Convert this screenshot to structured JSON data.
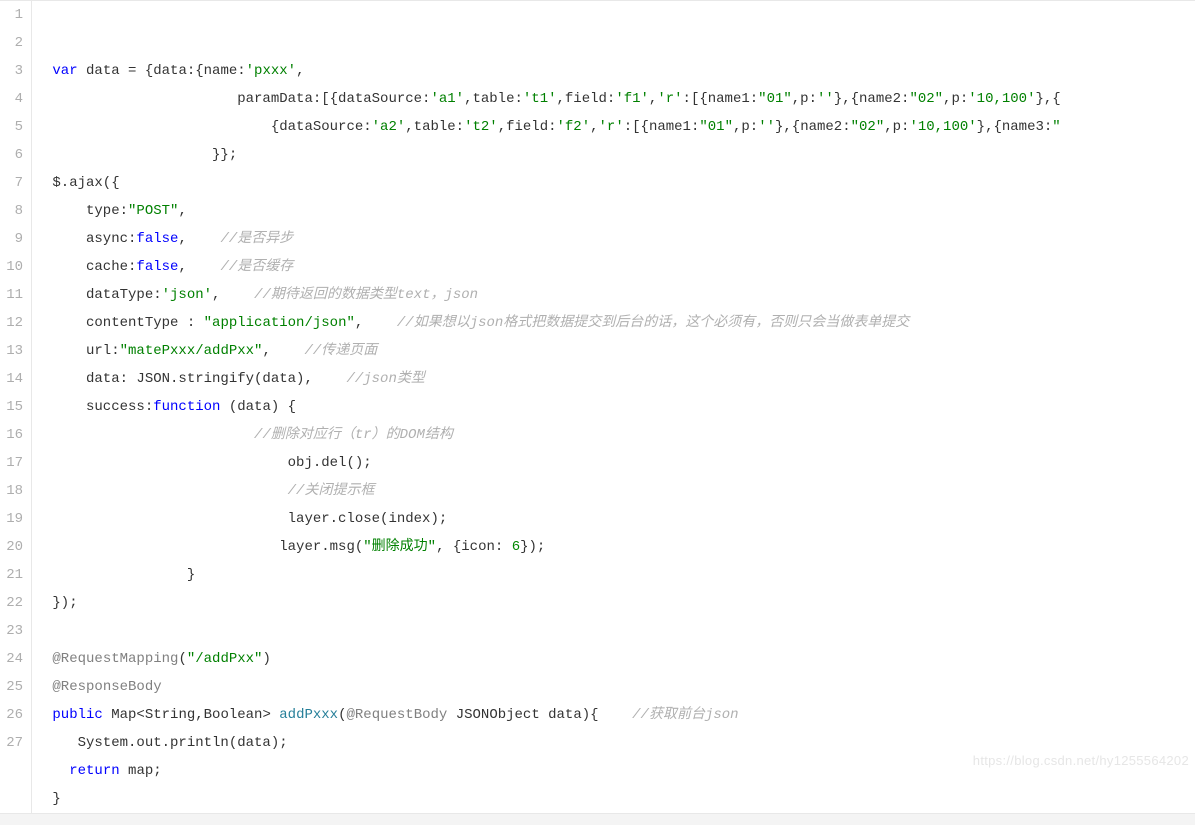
{
  "lines": [
    {
      "n": 1,
      "segs": [
        {
          "t": " ",
          "c": ""
        },
        {
          "t": "var",
          "c": "tok-kw"
        },
        {
          "t": " data = {data:{name:",
          "c": ""
        },
        {
          "t": "'pxxx'",
          "c": "tok-str"
        },
        {
          "t": ",",
          "c": ""
        }
      ]
    },
    {
      "n": 2,
      "segs": [
        {
          "t": "                       paramData:[{dataSource:",
          "c": ""
        },
        {
          "t": "'a1'",
          "c": "tok-str"
        },
        {
          "t": ",table:",
          "c": ""
        },
        {
          "t": "'t1'",
          "c": "tok-str"
        },
        {
          "t": ",field:",
          "c": ""
        },
        {
          "t": "'f1'",
          "c": "tok-str"
        },
        {
          "t": ",",
          "c": ""
        },
        {
          "t": "'r'",
          "c": "tok-str"
        },
        {
          "t": ":[{name1:",
          "c": ""
        },
        {
          "t": "\"01\"",
          "c": "tok-str"
        },
        {
          "t": ",p:",
          "c": ""
        },
        {
          "t": "''",
          "c": "tok-str"
        },
        {
          "t": "},{name2:",
          "c": ""
        },
        {
          "t": "\"02\"",
          "c": "tok-str"
        },
        {
          "t": ",p:",
          "c": ""
        },
        {
          "t": "'10,100'",
          "c": "tok-str"
        },
        {
          "t": "},{",
          "c": ""
        }
      ]
    },
    {
      "n": 3,
      "segs": [
        {
          "t": "                           {dataSource:",
          "c": ""
        },
        {
          "t": "'a2'",
          "c": "tok-str"
        },
        {
          "t": ",table:",
          "c": ""
        },
        {
          "t": "'t2'",
          "c": "tok-str"
        },
        {
          "t": ",field:",
          "c": ""
        },
        {
          "t": "'f2'",
          "c": "tok-str"
        },
        {
          "t": ",",
          "c": ""
        },
        {
          "t": "'r'",
          "c": "tok-str"
        },
        {
          "t": ":[{name1:",
          "c": ""
        },
        {
          "t": "\"01\"",
          "c": "tok-str"
        },
        {
          "t": ",p:",
          "c": ""
        },
        {
          "t": "''",
          "c": "tok-str"
        },
        {
          "t": "},{name2:",
          "c": ""
        },
        {
          "t": "\"02\"",
          "c": "tok-str"
        },
        {
          "t": ",p:",
          "c": ""
        },
        {
          "t": "'10,100'",
          "c": "tok-str"
        },
        {
          "t": "},{name3:",
          "c": ""
        },
        {
          "t": "\"",
          "c": "tok-str"
        }
      ]
    },
    {
      "n": 4,
      "segs": [
        {
          "t": "                    }};",
          "c": ""
        }
      ]
    },
    {
      "n": 5,
      "segs": [
        {
          "t": " $.ajax({",
          "c": ""
        }
      ]
    },
    {
      "n": 6,
      "segs": [
        {
          "t": "     type:",
          "c": ""
        },
        {
          "t": "\"POST\"",
          "c": "tok-str"
        },
        {
          "t": ",",
          "c": ""
        }
      ]
    },
    {
      "n": 7,
      "segs": [
        {
          "t": "     async:",
          "c": ""
        },
        {
          "t": "false",
          "c": "tok-bool"
        },
        {
          "t": ",    ",
          "c": ""
        },
        {
          "t": "//是否异步",
          "c": "tok-cmt"
        }
      ]
    },
    {
      "n": 8,
      "segs": [
        {
          "t": "     cache:",
          "c": ""
        },
        {
          "t": "false",
          "c": "tok-bool"
        },
        {
          "t": ",    ",
          "c": ""
        },
        {
          "t": "//是否缓存",
          "c": "tok-cmt"
        }
      ]
    },
    {
      "n": 9,
      "segs": [
        {
          "t": "     dataType:",
          "c": ""
        },
        {
          "t": "'json'",
          "c": "tok-str"
        },
        {
          "t": ",    ",
          "c": ""
        },
        {
          "t": "//期待返回的数据类型text，json",
          "c": "tok-cmt"
        }
      ]
    },
    {
      "n": 10,
      "segs": [
        {
          "t": "     contentType : ",
          "c": ""
        },
        {
          "t": "\"application/json\"",
          "c": "tok-str"
        },
        {
          "t": ",    ",
          "c": ""
        },
        {
          "t": "//如果想以json格式把数据提交到后台的话，这个必须有，否则只会当做表单提交",
          "c": "tok-cmt"
        }
      ]
    },
    {
      "n": 11,
      "segs": [
        {
          "t": "     url:",
          "c": ""
        },
        {
          "t": "\"matePxxx/addPxx\"",
          "c": "tok-str"
        },
        {
          "t": ",    ",
          "c": ""
        },
        {
          "t": "//传递页面",
          "c": "tok-cmt"
        }
      ]
    },
    {
      "n": 12,
      "segs": [
        {
          "t": "     data: JSON.stringify(data),    ",
          "c": ""
        },
        {
          "t": "//json类型",
          "c": "tok-cmt"
        }
      ]
    },
    {
      "n": 13,
      "segs": [
        {
          "t": "     success:",
          "c": ""
        },
        {
          "t": "function",
          "c": "tok-kw"
        },
        {
          "t": " (data) {",
          "c": ""
        }
      ]
    },
    {
      "n": 14,
      "segs": [
        {
          "t": "                         ",
          "c": ""
        },
        {
          "t": "//删除对应行（tr）的DOM结构",
          "c": "tok-cmt"
        }
      ]
    },
    {
      "n": 15,
      "segs": [
        {
          "t": "                             obj.del();",
          "c": ""
        }
      ]
    },
    {
      "n": 16,
      "segs": [
        {
          "t": "                             ",
          "c": ""
        },
        {
          "t": "//关闭提示框",
          "c": "tok-cmt"
        }
      ]
    },
    {
      "n": 17,
      "segs": [
        {
          "t": "                             layer.close(index);",
          "c": ""
        }
      ]
    },
    {
      "n": 18,
      "segs": [
        {
          "t": "                            layer.msg(",
          "c": ""
        },
        {
          "t": "\"删除成功\"",
          "c": "tok-str"
        },
        {
          "t": ", {icon: ",
          "c": ""
        },
        {
          "t": "6",
          "c": "tok-num"
        },
        {
          "t": "});",
          "c": ""
        }
      ]
    },
    {
      "n": 19,
      "segs": [
        {
          "t": "                 }",
          "c": ""
        }
      ]
    },
    {
      "n": 20,
      "segs": [
        {
          "t": " });",
          "c": ""
        }
      ]
    },
    {
      "n": 21,
      "segs": [
        {
          "t": " ",
          "c": ""
        }
      ]
    },
    {
      "n": 22,
      "segs": [
        {
          "t": " ",
          "c": ""
        },
        {
          "t": "@RequestMapping",
          "c": "tok-anno"
        },
        {
          "t": "(",
          "c": ""
        },
        {
          "t": "\"/addPxx\"",
          "c": "tok-str"
        },
        {
          "t": ")",
          "c": ""
        }
      ]
    },
    {
      "n": 23,
      "segs": [
        {
          "t": " ",
          "c": ""
        },
        {
          "t": "@ResponseBody",
          "c": "tok-anno"
        }
      ]
    },
    {
      "n": 24,
      "segs": [
        {
          "t": " ",
          "c": ""
        },
        {
          "t": "public",
          "c": "tok-kw"
        },
        {
          "t": " Map<String,Boolean> ",
          "c": ""
        },
        {
          "t": "addPxxx",
          "c": "tok-fn"
        },
        {
          "t": "(",
          "c": ""
        },
        {
          "t": "@RequestBody",
          "c": "tok-anno"
        },
        {
          "t": " JSONObject data){    ",
          "c": ""
        },
        {
          "t": "//获取前台json",
          "c": "tok-cmt"
        }
      ]
    },
    {
      "n": 25,
      "segs": [
        {
          "t": "    System.out.println(data);",
          "c": ""
        }
      ]
    },
    {
      "n": 26,
      "segs": [
        {
          "t": "   ",
          "c": ""
        },
        {
          "t": "return",
          "c": "tok-kw"
        },
        {
          "t": " map;",
          "c": ""
        }
      ]
    },
    {
      "n": 27,
      "segs": [
        {
          "t": " }",
          "c": ""
        }
      ]
    }
  ],
  "watermark": "https://blog.csdn.net/hy1255564202"
}
